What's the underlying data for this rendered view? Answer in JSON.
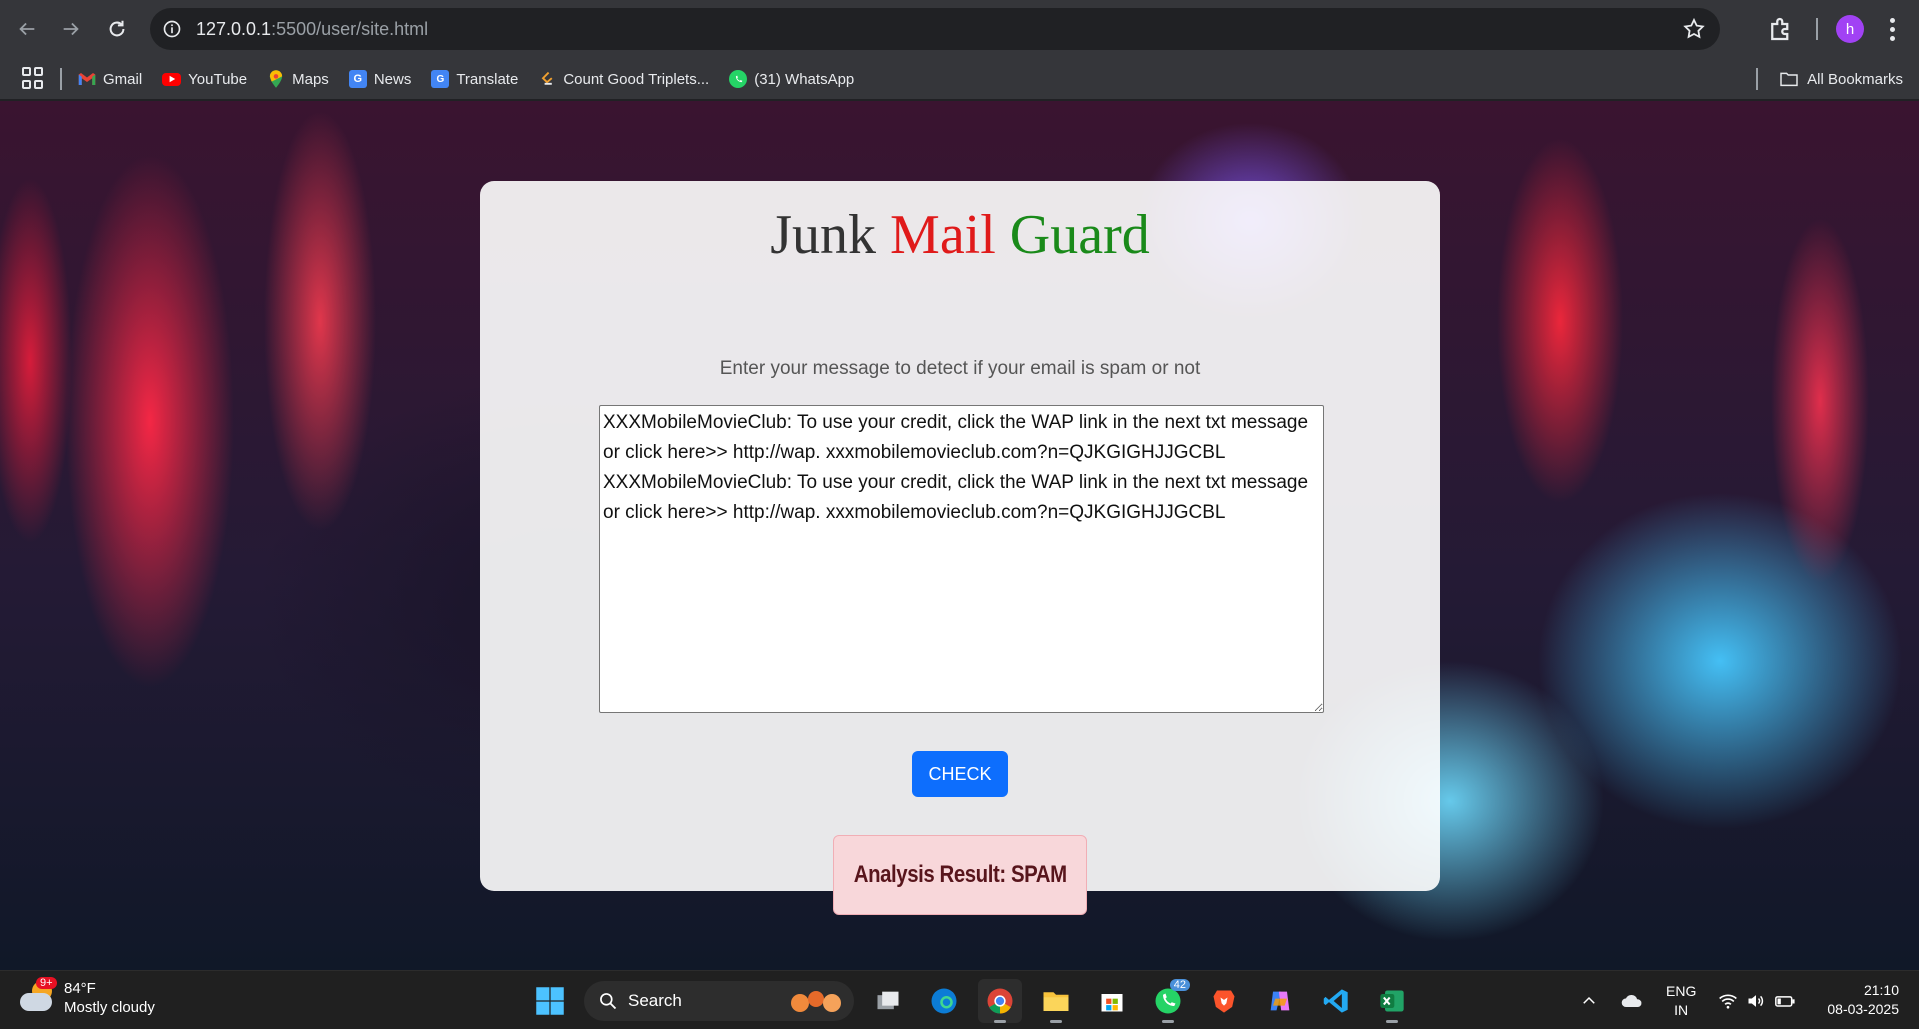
{
  "browser": {
    "url_host": "127.0.0.1",
    "url_rest": ":5500/user/site.html",
    "profile_initial": "h",
    "bookmarks": [
      {
        "label": "Gmail",
        "icon": "gmail-icon"
      },
      {
        "label": "YouTube",
        "icon": "youtube-icon"
      },
      {
        "label": "Maps",
        "icon": "maps-icon"
      },
      {
        "label": "News",
        "icon": "news-icon"
      },
      {
        "label": "Translate",
        "icon": "translate-icon"
      },
      {
        "label": "Count Good Triplets...",
        "icon": "leetcode-icon"
      },
      {
        "label": "(31) WhatsApp",
        "icon": "whatsapp-icon"
      }
    ],
    "all_bookmarks": "All Bookmarks"
  },
  "page": {
    "title_word1": "Junk",
    "title_word2": "Mail",
    "title_word3": "Guard",
    "subtitle": "Enter your message to detect if your email is spam or not",
    "message": "XXXMobileMovieClub: To use your credit, click the WAP link in the next txt message or click here>> http://wap. xxxmobilemovieclub.com?n=QJKGIGHJJGCBL    XXXMobileMovieClub: To use your credit, click the WAP link in the next txt message or click here>> http://wap. xxxmobilemovieclub.com?n=QJKGIGHJJGCBL",
    "check_label": "CHECK",
    "result": "Analysis Result: SPAM",
    "colors": {
      "mail": "#e01a1a",
      "guard": "#1a8a1a",
      "button": "#0d6efd",
      "result_bg": "#f8d7da"
    }
  },
  "taskbar": {
    "weather_temp": "84°F",
    "weather_desc": "Mostly cloudy",
    "weather_badge": "9+",
    "search_label": "Search",
    "whatsapp_count": "42",
    "lang_line1": "ENG",
    "lang_line2": "IN",
    "time": "21:10",
    "date": "08-03-2025"
  }
}
